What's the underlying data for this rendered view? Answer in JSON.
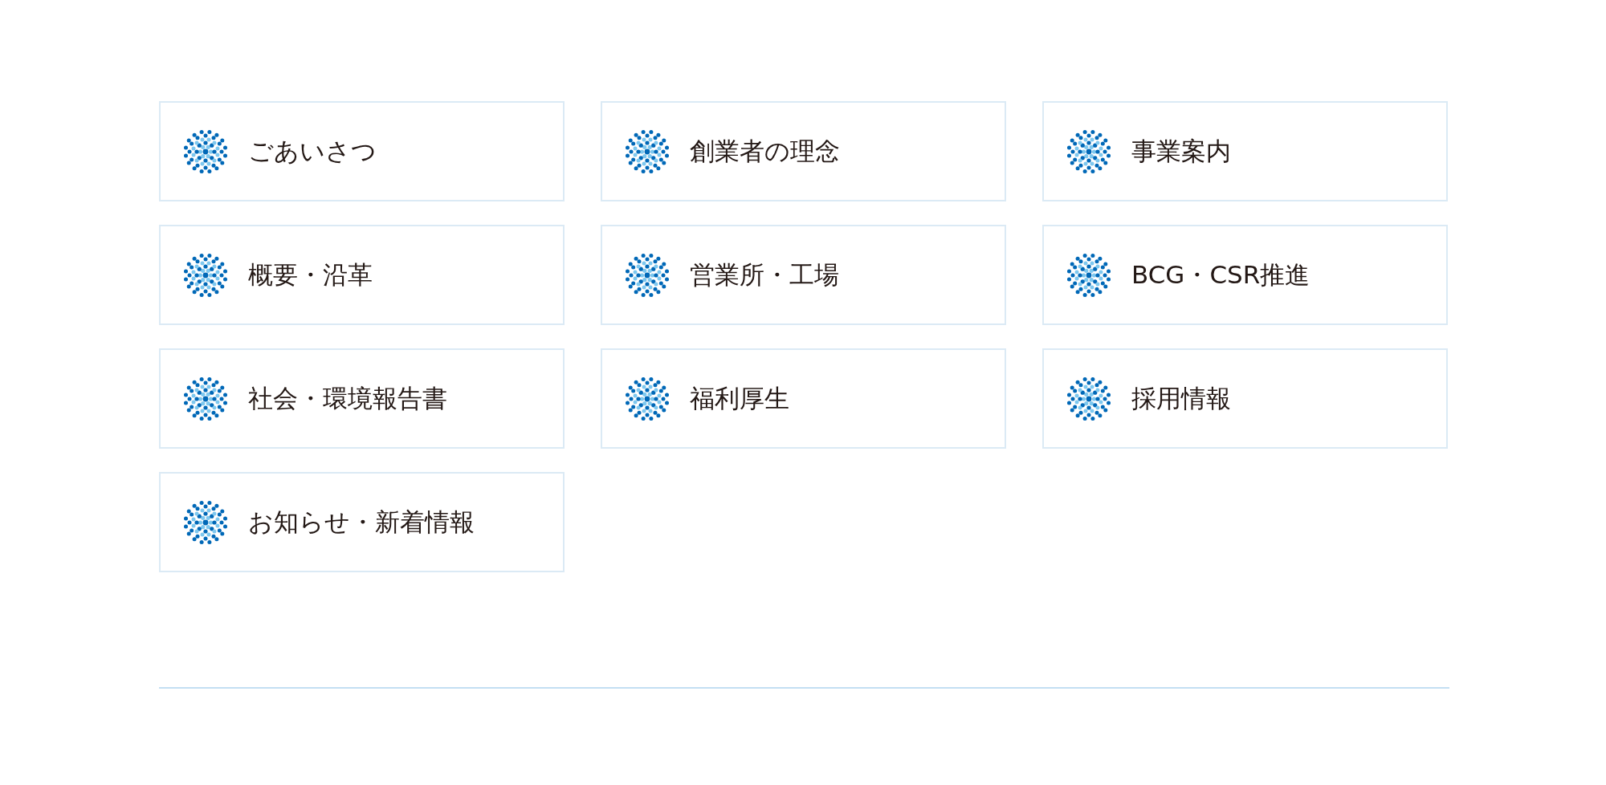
{
  "menu": [
    {
      "label": "ごあいさつ"
    },
    {
      "label": "創業者の理念"
    },
    {
      "label": "事業案内"
    },
    {
      "label": "概要・沿革"
    },
    {
      "label": "営業所・工場"
    },
    {
      "label": "BCG・CSR推進"
    },
    {
      "label": "社会・環境報告書"
    },
    {
      "label": "福利厚生"
    },
    {
      "label": "採用情報"
    },
    {
      "label": "お知らせ・新着情報"
    }
  ]
}
